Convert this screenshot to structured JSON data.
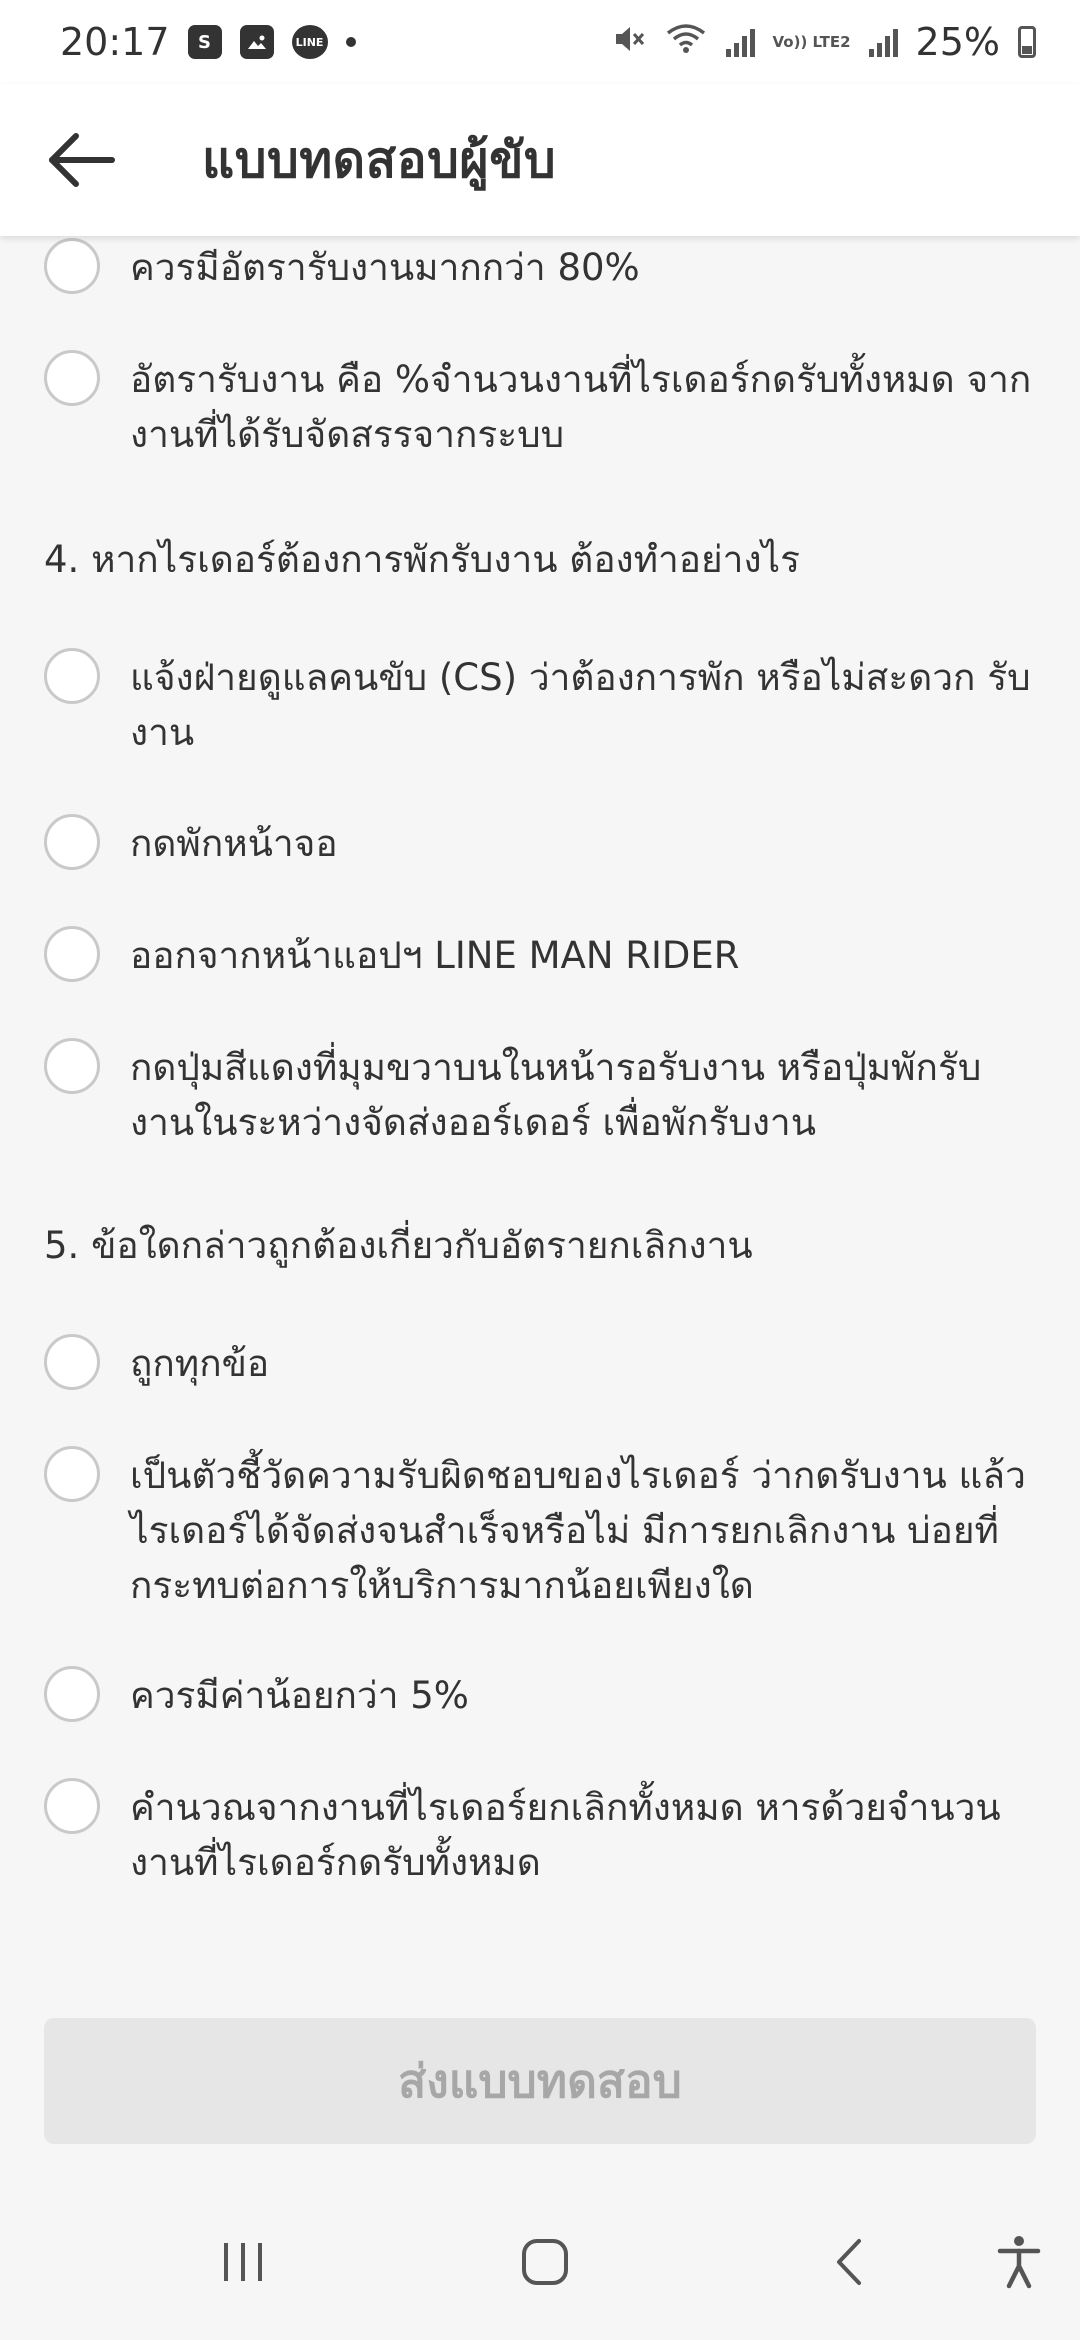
{
  "status_bar": {
    "time": "20:17",
    "battery": "25%",
    "left_icons": [
      "shopping-bag-icon",
      "gallery-icon",
      "line-icon",
      "dot-icon"
    ],
    "right_icons": [
      "mute-icon",
      "wifi-icon",
      "signal-icon",
      "volte-icon",
      "signal-icon",
      "battery-icon"
    ],
    "volte_label": "Vo)) LTE2"
  },
  "header": {
    "title": "แบบทดสอบผู้ขับ",
    "back_icon": "arrow-left-icon"
  },
  "quiz": {
    "prev_options": [
      "ควรมีอัตรารับงานมากกว่า 80%",
      "อัตรารับงาน คือ %จำนวนงานที่ไรเดอร์กดรับทั้งหมด จากงานที่ได้รับจัดสรรจากระบบ"
    ],
    "q4": {
      "question": "4. หากไรเดอร์ต้องการพักรับงาน ต้องทำอย่างไร",
      "options": [
        "แจ้งฝ่ายดูแลคนขับ (CS) ว่าต้องการพัก หรือไม่สะดวก รับงาน",
        "กดพักหน้าจอ",
        "ออกจากหน้าแอปฯ LINE MAN RIDER",
        "กดปุ่มสีแดงที่มุมขวาบนในหน้ารอรับงาน หรือปุ่มพักรับ งานในระหว่างจัดส่งออร์เดอร์ เพื่อพักรับงาน"
      ]
    },
    "q5": {
      "question": "5. ข้อใดกล่าวถูกต้องเกี่ยวกับอัตรายกเลิกงาน",
      "options": [
        "ถูกทุกข้อ",
        "เป็นตัวชี้วัดความรับผิดชอบของไรเดอร์ ว่ากดรับงาน แล้วไรเดอร์ได้จัดส่งจนสำเร็จหรือไม่ มีการยกเลิกงาน บ่อยที่กระทบต่อการให้บริการมากน้อยเพียงใด",
        "ควรมีค่าน้อยกว่า 5%",
        "คำนวณจากงานที่ไรเดอร์ยกเลิกทั้งหมด หารด้วยจำนวน งานที่ไรเดอร์กดรับทั้งหมด"
      ]
    }
  },
  "submit": {
    "label": "ส่งแบบทดสอบ"
  },
  "nav": {
    "icons": [
      "recent-apps-icon",
      "home-icon",
      "back-icon",
      "accessibility-icon"
    ]
  },
  "colors": {
    "background": "#f6f6f6",
    "header_bg": "#ffffff",
    "text": "#333333",
    "radio_border": "#c9c9c9",
    "submit_disabled_bg": "#e6e6e6",
    "submit_disabled_text": "#a7a7a7"
  }
}
